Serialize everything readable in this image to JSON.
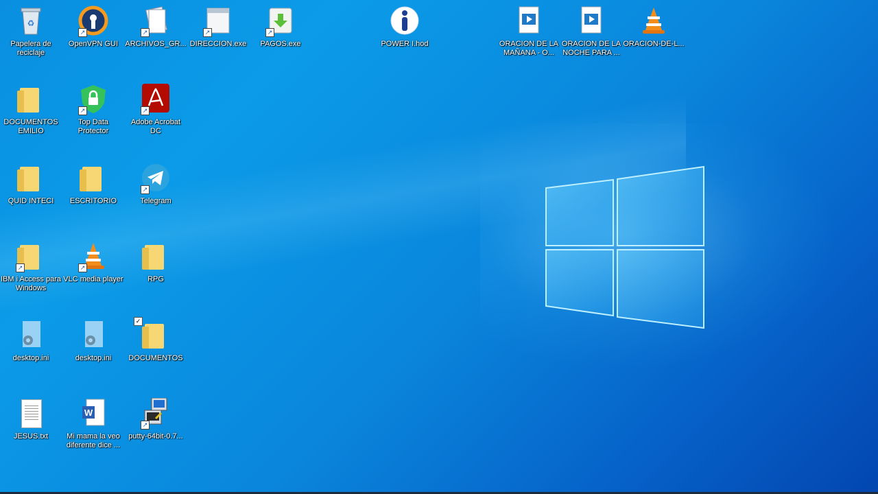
{
  "desktop": {
    "icons": [
      {
        "label": "Papelera de reciclaje",
        "icon": "recycle-bin-icon"
      },
      {
        "label": "OpenVPN GUI",
        "icon": "openvpn-icon"
      },
      {
        "label": "ARCHIVOS_GR...",
        "icon": "archive-file-icon"
      },
      {
        "label": "DIRECCION.exe",
        "icon": "exe-window-icon"
      },
      {
        "label": "PAGOS.exe",
        "icon": "installer-icon"
      },
      {
        "label": "POWER I.hod",
        "icon": "info-icon"
      },
      {
        "label": "ORACION DE LA MAÑANA - O...",
        "icon": "video-file-icon"
      },
      {
        "label": "ORACION DE LA NOCHE PARA ...",
        "icon": "video-file-icon"
      },
      {
        "label": "ORACION-DE-L...",
        "icon": "vlc-cone-icon"
      },
      {
        "label": "DOCUMENTOS EMILIO",
        "icon": "folder-icon"
      },
      {
        "label": "Top Data Protector",
        "icon": "shield-lock-icon"
      },
      {
        "label": "Adobe Acrobat DC",
        "icon": "acrobat-icon"
      },
      {
        "label": "QUID INTECI",
        "icon": "folder-icon"
      },
      {
        "label": "ESCRITORIO",
        "icon": "folder-icon"
      },
      {
        "label": "Telegram",
        "icon": "telegram-icon"
      },
      {
        "label": "IBM i Access para Windows",
        "icon": "folder-icon"
      },
      {
        "label": "VLC media player",
        "icon": "vlc-cone-icon"
      },
      {
        "label": "RPG",
        "icon": "folder-icon"
      },
      {
        "label": "desktop.ini",
        "icon": "settings-file-icon"
      },
      {
        "label": "desktop.ini",
        "icon": "settings-file-icon"
      },
      {
        "label": "DOCUMENTOS",
        "icon": "folder-icon"
      },
      {
        "label": "JESUS.txt",
        "icon": "text-file-icon"
      },
      {
        "label": "Mi mama la veo diferente dice ...",
        "icon": "word-doc-icon"
      },
      {
        "label": "putty-64bit-0.7...",
        "icon": "putty-icon"
      }
    ]
  },
  "colors": {
    "wallpaper_primary": "#0a8fe0",
    "wallpaper_dark": "#0346b0",
    "windows_logo": "#7fd6ff"
  }
}
